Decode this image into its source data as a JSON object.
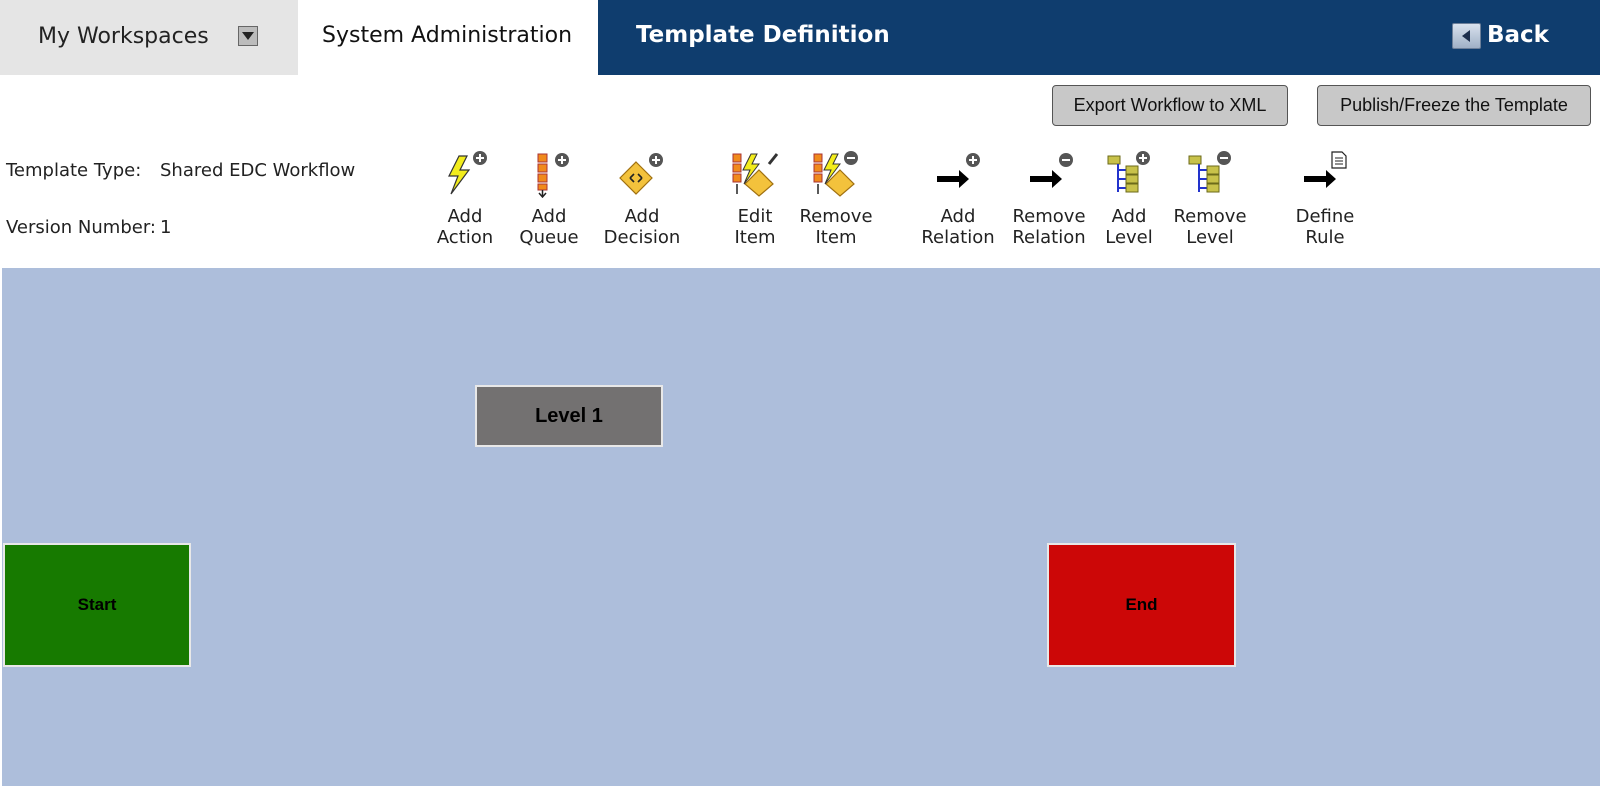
{
  "header": {
    "workspace_label": "My Workspaces",
    "tab_label": "System Administration",
    "page_title": "Template Definition",
    "back_label": "Back"
  },
  "actions": {
    "export_label": "Export Workflow to XML",
    "publish_label": "Publish/Freeze the Template"
  },
  "info": {
    "template_type_label": "Template Type:",
    "template_type_value": "Shared EDC Workflow",
    "version_label": "Version Number:",
    "version_value": "1"
  },
  "toolbar": {
    "add_action": {
      "line1": "Add",
      "line2": "Action",
      "icon": "add-action-icon"
    },
    "add_queue": {
      "line1": "Add",
      "line2": "Queue",
      "icon": "add-queue-icon"
    },
    "add_decision": {
      "line1": "Add",
      "line2": "Decision",
      "icon": "add-decision-icon"
    },
    "edit_item": {
      "line1": "Edit",
      "line2": "Item",
      "icon": "edit-item-icon"
    },
    "remove_item": {
      "line1": "Remove",
      "line2": "Item",
      "icon": "remove-item-icon"
    },
    "add_relation": {
      "line1": "Add",
      "line2": "Relation",
      "icon": "add-relation-icon"
    },
    "remove_relation": {
      "line1": "Remove",
      "line2": "Relation",
      "icon": "remove-relation-icon"
    },
    "add_level": {
      "line1": "Add",
      "line2": "Level",
      "icon": "add-level-icon"
    },
    "remove_level": {
      "line1": "Remove",
      "line2": "Level",
      "icon": "remove-level-icon"
    },
    "define_rule": {
      "line1": "Define",
      "line2": "Rule",
      "icon": "define-rule-icon"
    }
  },
  "workflow": {
    "level_label": "Level 1",
    "start_label": "Start",
    "end_label": "End"
  },
  "colors": {
    "header_blue": "#0f3d6e",
    "canvas": "#adbedb",
    "start_green": "#177a00",
    "end_red": "#cc0707",
    "level_gray": "#737171"
  }
}
